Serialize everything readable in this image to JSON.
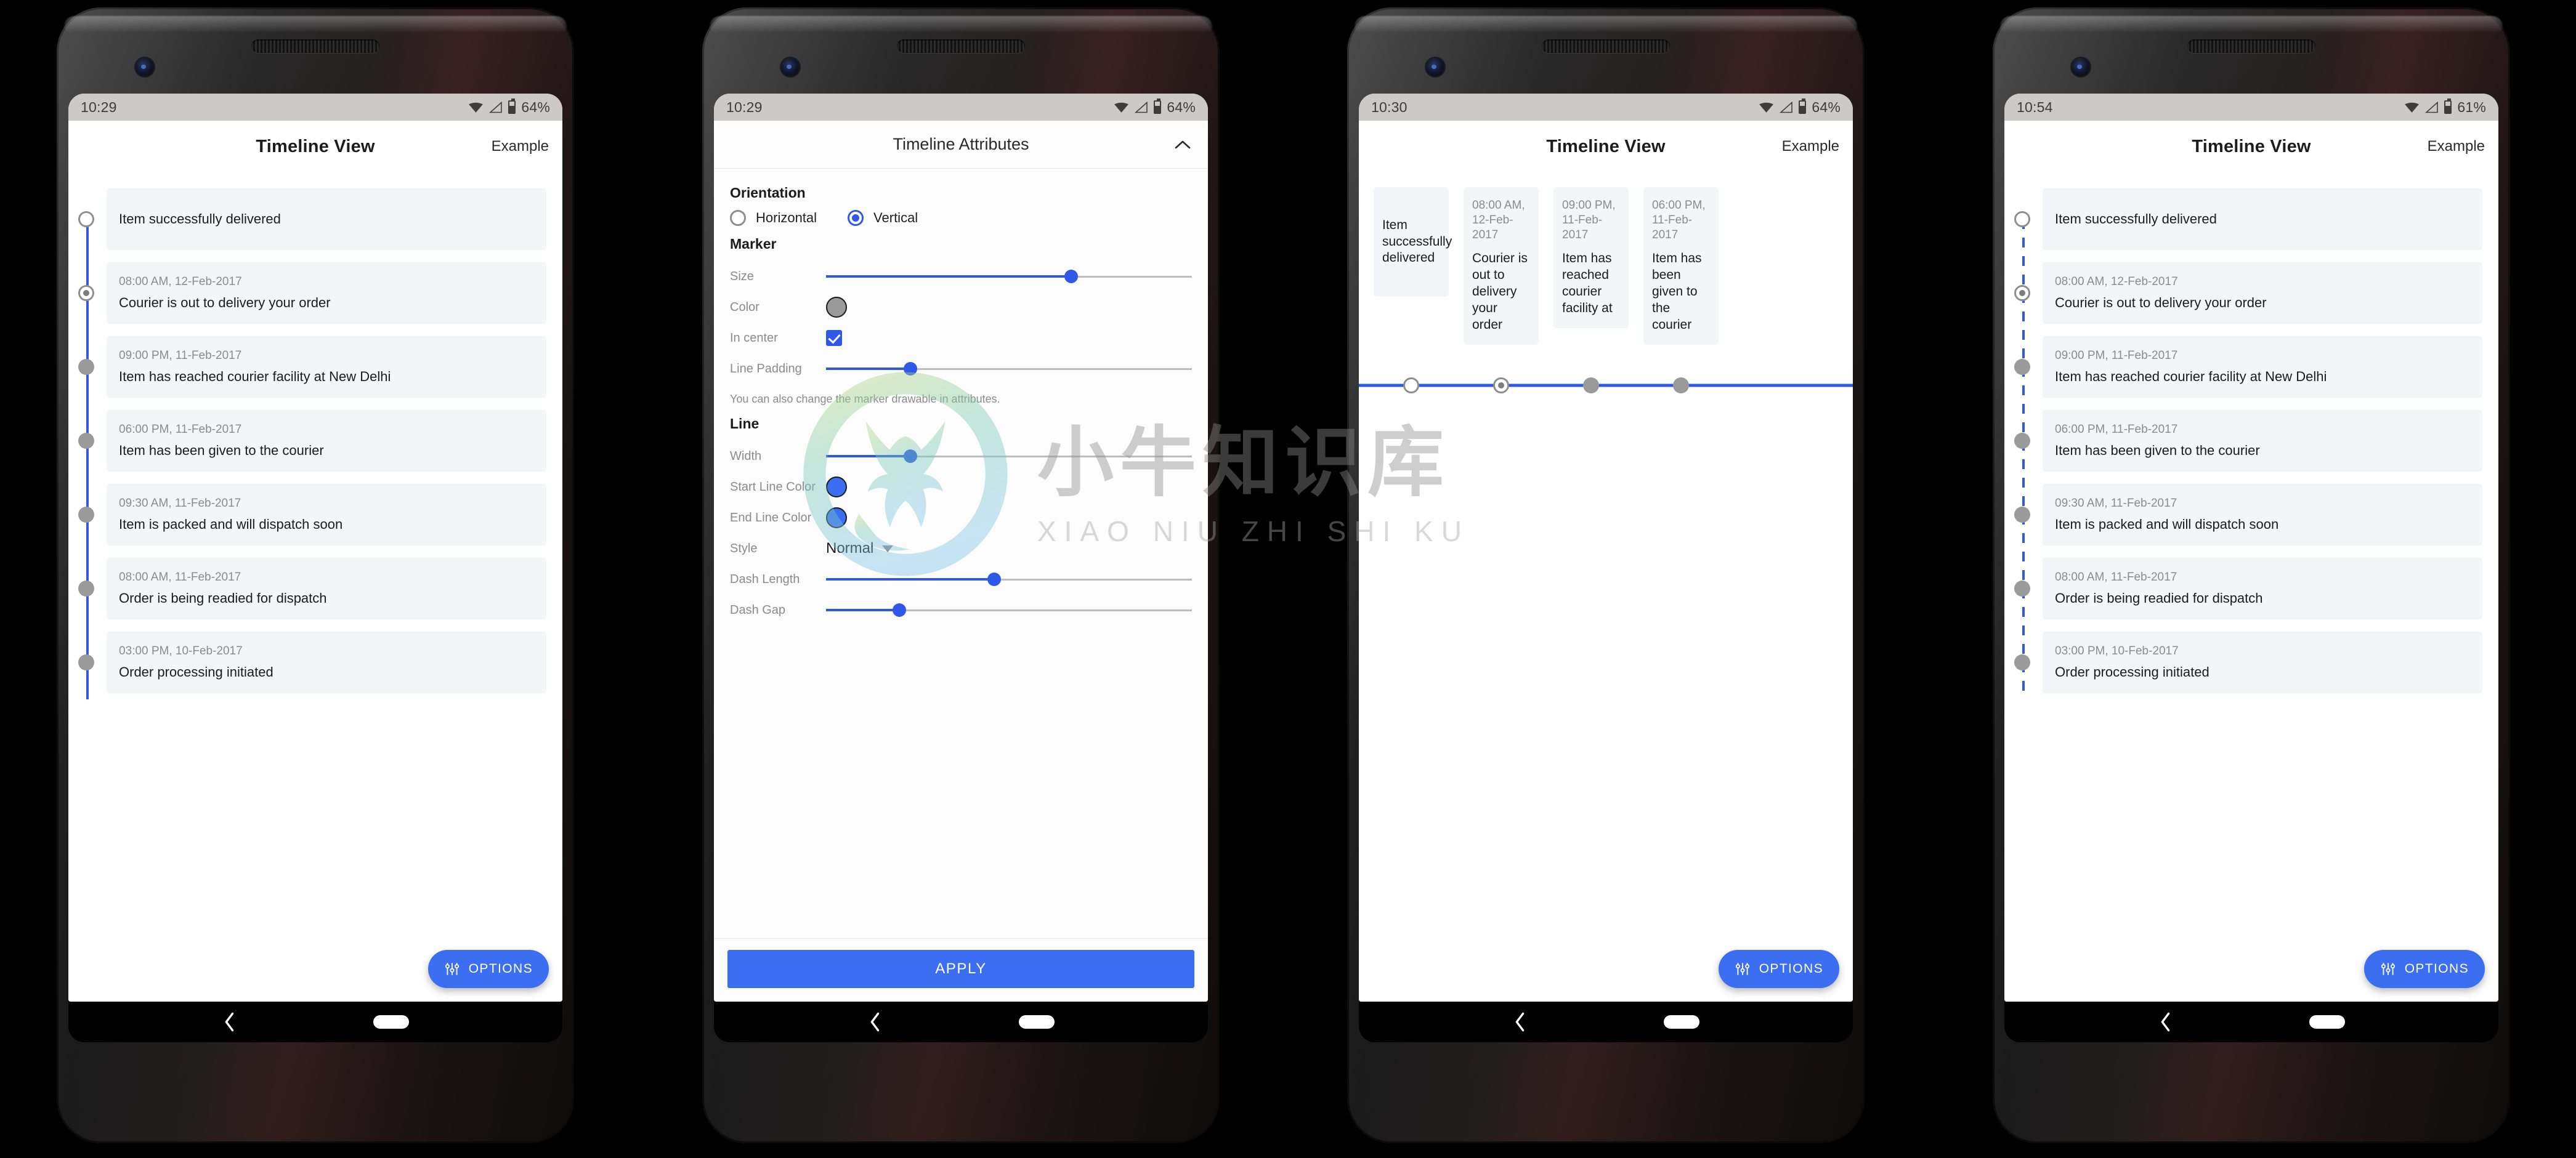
{
  "colors": {
    "accent": "#2f58e8",
    "fab": "#3b6ef0",
    "card_bg": "#f2f6f8",
    "marker_grey": "#9a9a9a",
    "statusbar_bg": "#ccc9c7",
    "muted_text": "#8b8b8b"
  },
  "watermark": {
    "cn": "小牛知识库",
    "en": "XIAO NIU ZHI SHI KU"
  },
  "phones": [
    {
      "id": "phone-vertical-solid",
      "statusbar": {
        "time": "10:29",
        "battery": "64%",
        "wifi_icon": "wifi-icon",
        "signal_icon": "signal-icon",
        "battery_icon": "battery-icon"
      },
      "appbar": {
        "title": "Timeline View",
        "action": "Example"
      },
      "mode": "vertical",
      "line_style": "solid",
      "fab": {
        "label": "OPTIONS",
        "icon": "tune-sliders-icon"
      },
      "items": [
        {
          "time": "",
          "text": "Item successfully delivered",
          "marker": "empty"
        },
        {
          "time": "08:00 AM, 12-Feb-2017",
          "text": "Courier is out to delivery your order",
          "marker": "active"
        },
        {
          "time": "09:00 PM, 11-Feb-2017",
          "text": "Item has reached courier facility at New Delhi",
          "marker": "filled"
        },
        {
          "time": "06:00 PM, 11-Feb-2017",
          "text": "Item has been given to the courier",
          "marker": "filled"
        },
        {
          "time": "09:30 AM, 11-Feb-2017",
          "text": "Item is packed and will dispatch soon",
          "marker": "filled"
        },
        {
          "time": "08:00 AM, 11-Feb-2017",
          "text": "Order is being readied for dispatch",
          "marker": "filled"
        },
        {
          "time": "03:00 PM, 10-Feb-2017",
          "text": "Order processing initiated",
          "marker": "filled"
        }
      ]
    },
    {
      "id": "phone-attributes-sheet",
      "statusbar": {
        "time": "10:29",
        "battery": "64%",
        "wifi_icon": "wifi-icon",
        "signal_icon": "signal-icon",
        "battery_icon": "battery-icon"
      },
      "sheet": {
        "title": "Timeline Attributes",
        "collapse_icon": "chevron-up-icon",
        "orientation": {
          "group_label": "Orientation",
          "options": [
            {
              "label": "Horizontal",
              "selected": false
            },
            {
              "label": "Vertical",
              "selected": true
            }
          ]
        },
        "marker": {
          "group_label": "Marker",
          "size_label": "Size",
          "size_percent": 67,
          "color_label": "Color",
          "color_value": "#9a9a9a",
          "in_center_label": "In center",
          "in_center_checked": true,
          "line_padding_label": "Line Padding",
          "line_padding_percent": 23,
          "hint": "You can also change the marker drawable in attributes."
        },
        "line": {
          "group_label": "Line",
          "width_label": "Width",
          "width_percent": 23,
          "start_color_label": "Start Line Color",
          "start_color_value": "#3b6ef0",
          "end_color_label": "End Line Color",
          "end_color_value": "#3b6ef0",
          "style_label": "Style",
          "style_value": "Normal",
          "dash_length_label": "Dash Length",
          "dash_length_percent": 46,
          "dash_gap_label": "Dash Gap",
          "dash_gap_percent": 20
        },
        "apply_label": "APPLY"
      }
    },
    {
      "id": "phone-horizontal",
      "statusbar": {
        "time": "10:30",
        "battery": "64%",
        "wifi_icon": "wifi-icon",
        "signal_icon": "signal-icon",
        "battery_icon": "battery-icon"
      },
      "appbar": {
        "title": "Timeline View",
        "action": "Example"
      },
      "mode": "horizontal",
      "line_style": "solid",
      "fab": {
        "label": "OPTIONS",
        "icon": "tune-sliders-icon"
      },
      "items": [
        {
          "time": "",
          "text": "Item successfully delivered",
          "marker": "empty"
        },
        {
          "time": "08:00 AM, 12-Feb-2017",
          "text": "Courier is out to delivery your order",
          "marker": "active"
        },
        {
          "time": "09:00 PM, 11-Feb-2017",
          "text": "Item has reached courier facility at",
          "marker": "filled"
        },
        {
          "time": "06:00 PM, 11-Feb-2017",
          "text": "Item has been given to the courier",
          "marker": "filled"
        }
      ]
    },
    {
      "id": "phone-vertical-dashed",
      "statusbar": {
        "time": "10:54",
        "battery": "61%",
        "wifi_icon": "wifi-icon",
        "signal_icon": "signal-icon",
        "battery_icon": "battery-icon"
      },
      "appbar": {
        "title": "Timeline View",
        "action": "Example"
      },
      "mode": "vertical",
      "line_style": "dashed",
      "fab": {
        "label": "OPTIONS",
        "icon": "tune-sliders-icon"
      },
      "items": [
        {
          "time": "",
          "text": "Item successfully delivered",
          "marker": "empty"
        },
        {
          "time": "08:00 AM, 12-Feb-2017",
          "text": "Courier is out to delivery your order",
          "marker": "active"
        },
        {
          "time": "09:00 PM, 11-Feb-2017",
          "text": "Item has reached courier facility at New Delhi",
          "marker": "filled"
        },
        {
          "time": "06:00 PM, 11-Feb-2017",
          "text": "Item has been given to the courier",
          "marker": "filled"
        },
        {
          "time": "09:30 AM, 11-Feb-2017",
          "text": "Item is packed and will dispatch soon",
          "marker": "filled"
        },
        {
          "time": "08:00 AM, 11-Feb-2017",
          "text": "Order is being readied for dispatch",
          "marker": "filled"
        },
        {
          "time": "03:00 PM, 10-Feb-2017",
          "text": "Order processing initiated",
          "marker": "filled"
        }
      ]
    }
  ],
  "navbar": {
    "back_icon": "back-chevron-icon",
    "home_icon": "home-pill-icon"
  }
}
